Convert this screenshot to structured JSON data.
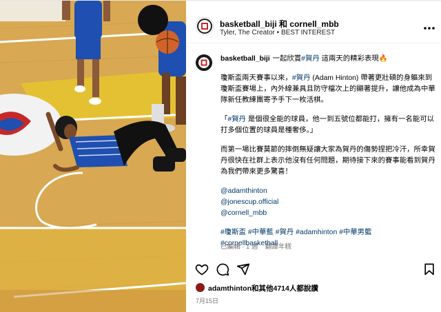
{
  "header": {
    "account": "basketball_biji",
    "connector": "和",
    "coauthor": "cornell_mbb",
    "audio_artist": "Tyler, The Creator",
    "audio_separator": "•",
    "audio_track": "BEST INTEREST",
    "more_icon": "more-horizontal-icon",
    "avatar_text": "籃球\n筆記"
  },
  "caption": {
    "username": "basketball_biji",
    "line1_a": "一起欣賞",
    "line1_tag": "#賀丹",
    "line1_b": "這兩天的精彩表現🔥",
    "p1_a": "瓊斯盃兩天賽事以來，",
    "p1_tag": "#賀丹",
    "p1_b": "(Adam Hinton) 帶著更壯碩的身軀來到瓊斯盃賽場上，內外線兼具且防守檔次上的顯著提升，讓他成為中華隊新任教練團寄予手下一枚活棋。",
    "p2_a": "「",
    "p2_tag": "#賀丹",
    "p2_b": "是個很全能的球員，他一到五號位都能打，擁有一名能可以打多個位置的球員是種奢侈。」",
    "p3": "而第一場比賽莫節的摔倒無疑讓大家為賀丹的傷勢捏把冷汗，所幸賀丹很快在社群上表示他沒有任何問題，期待接下來的賽事能看到賀丹為我們帶來更多驚喜！",
    "mentions": [
      "@adamthinton",
      "@jonescup.official",
      "@cornell_mbb"
    ],
    "hashtags_line1": [
      "#瓊斯盃",
      "#中華藍",
      "#賀丹",
      "#adamhinton",
      "#中華男籃"
    ],
    "hashtags_line2": [
      "#cornellbasketball"
    ]
  },
  "meta": {
    "edited": "已編輯",
    "dot": "·",
    "age": "1 週",
    "translate": "翻譯年糕"
  },
  "actions": {
    "like_icon": "heart-icon",
    "comment_icon": "comment-icon",
    "share_icon": "send-icon",
    "save_icon": "bookmark-icon"
  },
  "likes": {
    "user": "adamthinton",
    "text": "和其他4714人都說讚"
  },
  "date": "7月15日",
  "colors": {
    "link": "#00376b",
    "muted": "#737373",
    "court": "#d9a94c",
    "jersey": "#1f4fb0"
  }
}
